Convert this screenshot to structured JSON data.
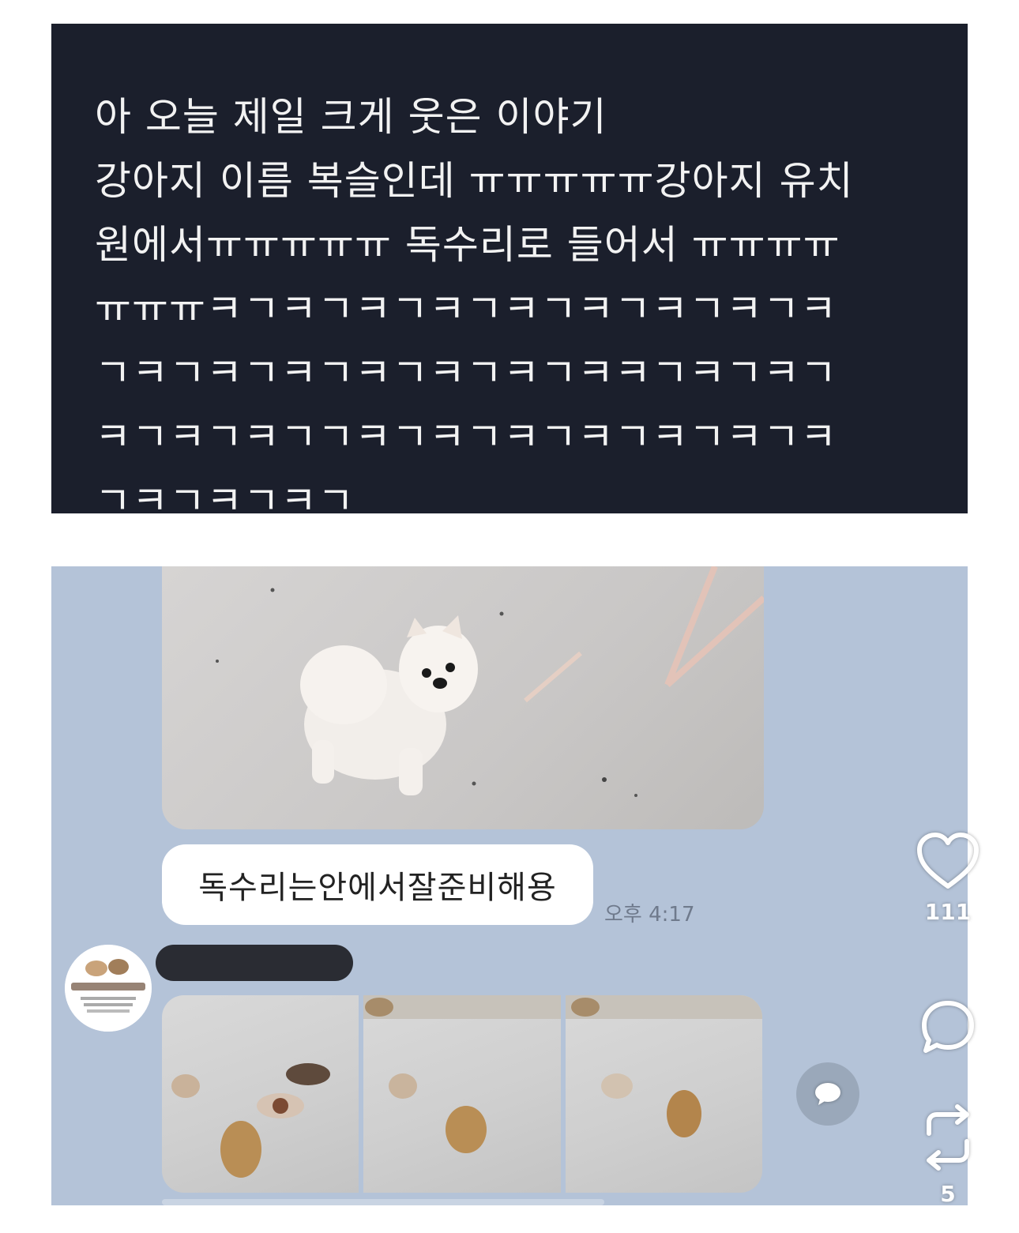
{
  "tweet": {
    "lines": [
      "아 오늘 제일 크게 웃은 이야기",
      "강아지 이름 복슬인데 ㅠㅠㅠㅠㅠ강아지 유치",
      "원에서ㅠㅠㅠㅠㅠ 독수리로 들어서 ㅠㅠㅠㅠ",
      "ㅠㅠㅠㅋㄱㅋㄱㅋㄱㅋㄱㅋㄱㅋㄱㅋㄱㅋㄱㅋ",
      "ㄱㅋㄱㅋㄱㅋㄱㅋㄱㅋㄱㅋㄱㅋㅋㄱㅋㄱㅋㄱ",
      "ㅋㄱㅋㄱㅋㄱㄱㅋㄱㅋㄱㅋㄱㅋㄱㅋㄱㅋㄱㅋ",
      "ㄱㅋㄱㅋㄱㅋㄱ"
    ],
    "text": "아 오늘 제일 크게 웃은 이야기\n강아지 이름 복슬인데 ㅠㅠㅠㅠㅠ강아지 유치\n원에서ㅠㅠㅠㅠㅠ 독수리로 들어서 ㅠㅠㅠㅠ\nㅠㅠㅠㅋㄱㅋㄱㅋㄱㅋㄱㅋㄱㅋㄱㅋㄱㅋㄱㅋ\nㄱㅋㄱㅋㄱㅋㄱㅋㄱㅋㄱㅋㄱㅋㅋㄱㅋㄱㅋㄱ\nㅋㄱㅋㄱㅋㄱㄱㅋㄱㅋㄱㅋㄱㅋㄱㅋㄱㅋㄱㅋ\nㄱㅋㄱㅋㄱㅋㄱ"
  },
  "chat": {
    "message": "독수리는안에서잘준비해용",
    "time": "오후 4:17",
    "share_icon": "speech-bubble-icon"
  },
  "actions": {
    "like": {
      "icon": "heart-icon",
      "count": "111"
    },
    "comment": {
      "icon": "comment-icon"
    },
    "repost": {
      "icon": "repost-icon",
      "count": "5"
    }
  },
  "colors": {
    "tweet_bg": "#1b1f2c",
    "tweet_text": "#f2f2f2",
    "chat_bg": "#b4c3d8",
    "bubble_bg": "#ffffff"
  }
}
